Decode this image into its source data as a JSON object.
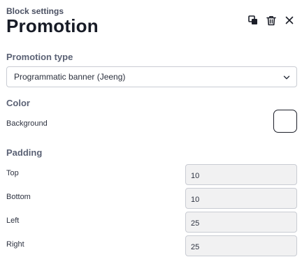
{
  "header": {
    "eyebrow": "Block settings",
    "title": "Promotion"
  },
  "toolbar": {
    "icons": [
      "duplicate-icon",
      "trash-icon",
      "close-icon"
    ]
  },
  "promotion_type": {
    "label": "Promotion type",
    "selected": "Programmatic banner (Jeeng)"
  },
  "color": {
    "label": "Color",
    "background_label": "Background",
    "background_value": "#ffffff"
  },
  "padding": {
    "label": "Padding",
    "fields": [
      {
        "label": "Top",
        "value": "10"
      },
      {
        "label": "Bottom",
        "value": "10"
      },
      {
        "label": "Left",
        "value": "25"
      },
      {
        "label": "Right",
        "value": "25"
      }
    ]
  }
}
